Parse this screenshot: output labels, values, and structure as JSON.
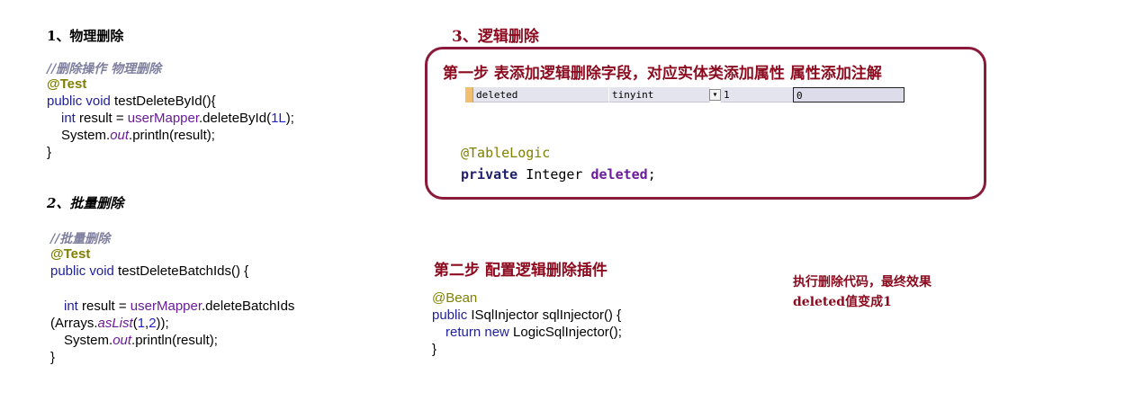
{
  "sections": {
    "s1": {
      "title": "1、物理删除",
      "comment": "//删除操作 物理删除",
      "annotation": "@Test",
      "line1": {
        "kw": "public void",
        "rest": " testDeleteById(){"
      },
      "line2": {
        "kw": "int",
        "mid": " result = ",
        "field": "userMapper",
        "call": ".deleteById(",
        "num": "1L",
        "end": ");"
      },
      "line3": {
        "pre": "System.",
        "static": "out",
        "post": ".println(result);"
      },
      "close": "}"
    },
    "s2": {
      "title": "2、批量删除",
      "comment": "//批量删除",
      "annotation": "@Test",
      "line1": {
        "kw": "public void",
        "rest": " testDeleteBatchIds() {"
      },
      "line2": {
        "kw": "int",
        "mid": " result = ",
        "field": "userMapper",
        "call": ".deleteBatchIds"
      },
      "line3": {
        "pre": "(Arrays.",
        "static": "asList",
        "open": "(",
        "n1": "1",
        "comma": ",",
        "n2": "2",
        "end": "));"
      },
      "line4": {
        "pre": "System.",
        "static": "out",
        "post": ".println(result);"
      },
      "close": "}"
    },
    "s3": {
      "title": "3、逻辑删除",
      "step1": "第一步 表添加逻辑删除字段，对应实体类添加属性 属性添加注解",
      "table_row": {
        "name": "deleted",
        "type": "tinyint",
        "dropdown": "▾",
        "length": "1",
        "default": "0"
      },
      "annotation": "@TableLogic",
      "field_line": {
        "kw": "private",
        "type": " Integer ",
        "name": "deleted",
        "end": ";"
      },
      "step2": "第二步 配置逻辑删除插件",
      "bean": "@Bean",
      "bean_line1": {
        "kw": "public",
        "rest": " ISqlInjector sqlInjector() {"
      },
      "bean_line2": {
        "kw1": "return",
        "sp": " ",
        "kw2": "new",
        "rest": " LogicSqlInjector();"
      },
      "close": "}",
      "result_line1": "执行删除代码，最终效果",
      "result_line2": "deleted值变成1"
    }
  },
  "colors": {
    "accent": "#8b0a1e",
    "keyword": "#1f1f9a",
    "annotation": "#808000",
    "field": "#6a1b9a"
  }
}
